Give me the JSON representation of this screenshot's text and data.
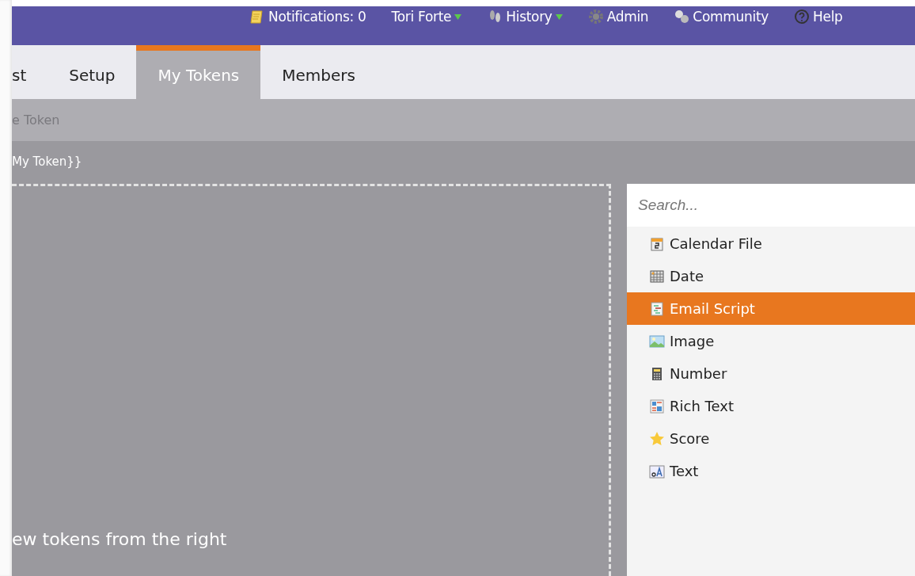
{
  "top_nav": [
    {
      "label": "Notifications: 0",
      "dropdown": false
    },
    {
      "label": "Tori Forte",
      "dropdown": true
    },
    {
      "label": "History",
      "dropdown": true
    },
    {
      "label": "Admin",
      "dropdown": false
    },
    {
      "label": "Community",
      "dropdown": false
    },
    {
      "label": "Help",
      "dropdown": false
    }
  ],
  "tabs": [
    {
      "label": "st",
      "selected": false
    },
    {
      "label": "Setup",
      "selected": false
    },
    {
      "label": "My Tokens",
      "selected": true
    },
    {
      "label": "Members",
      "selected": false
    }
  ],
  "toolbar": {
    "action": "e Token"
  },
  "token_name": "My Token}}",
  "drop_zone": {
    "hint": "ew tokens from the right"
  },
  "token_picker": {
    "search": {
      "placeholder": "Search..."
    },
    "items": [
      {
        "label": "Calendar File",
        "selected": false
      },
      {
        "label": "Date",
        "selected": false
      },
      {
        "label": "Email Script",
        "selected": true
      },
      {
        "label": "Image",
        "selected": false
      },
      {
        "label": "Number",
        "selected": false
      },
      {
        "label": "Rich Text",
        "selected": false
      },
      {
        "label": "Score",
        "selected": false
      },
      {
        "label": "Text",
        "selected": false
      }
    ]
  }
}
